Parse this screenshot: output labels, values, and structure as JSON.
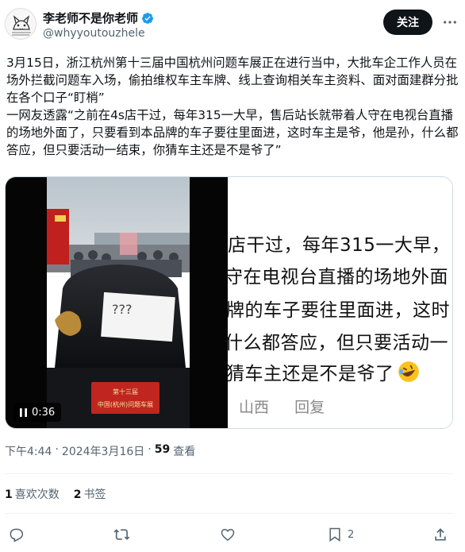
{
  "author": {
    "display_name": "李老师不是你老师",
    "handle": "@whyyoutouzhele",
    "avatar_icon": "avatar-cat-sketch-icon",
    "verified_icon": "verified-badge-icon",
    "verified_color": "#1d9bf0"
  },
  "follow_label": "关注",
  "tweet": {
    "paragraph1": "3月15日，浙江杭州第十三届中国杭州问题车展正在进行当中，大批车企工作人员在场外拦截问题车入场，偷拍维权车主车牌、线上查询相关车主资料、面对面建群分批在各个口子“盯梢”",
    "paragraph2": " 一网友透露“之前在4s店干过，每年315一大早，售后站长就带着人守在电视台直播的场地外面了，只要看到本品牌的车子要往里面进，这时车主是爷，他是孙，什么都答应，但只要活动一结束，你猜车主还是不是爷了”"
  },
  "media": {
    "duration": "0:36",
    "pause_icon": "pause-icon",
    "sign_text": "第十三届",
    "plate_text": "中国(杭州)问题车展",
    "paper_text": "???",
    "screen_lines": [
      "店干过，每年315一大早，",
      "守在电视台直播的场地外面",
      "牌的车子要往里面进，这时",
      "什么都答应，但只要活动一",
      "猜车主还是不是爷了"
    ],
    "screen_emoji": "rolling-on-floor-laughing-emoji",
    "screen_meta": [
      "山西",
      "回复"
    ]
  },
  "meta": {
    "time": "下午4:44",
    "separator": "·",
    "date": "2024年3月16日",
    "views_count": "59",
    "views_label": "查看"
  },
  "stats": {
    "likes_count": "1",
    "likes_label": "喜欢次数",
    "bookmarks_count": "2",
    "bookmarks_label": "书签"
  },
  "actions": {
    "reply_icon": "reply-icon",
    "retweet_icon": "retweet-icon",
    "like_icon": "heart-icon",
    "bookmark_icon": "bookmark-icon",
    "bookmark_count": "2",
    "share_icon": "share-icon"
  },
  "colors": {
    "text_primary": "#0f1419",
    "text_secondary": "#536471",
    "follow_bg": "#0f1419",
    "divider": "#eff3f4"
  }
}
